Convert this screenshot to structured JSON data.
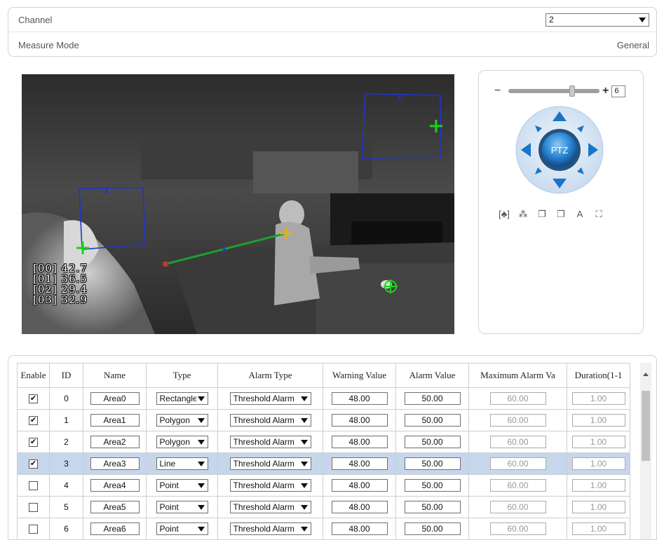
{
  "settings": {
    "channel_label": "Channel",
    "channel_value": "2",
    "measure_mode_label": "Measure Mode",
    "measure_mode_value": "General"
  },
  "video": {
    "osd_lines": [
      "[00] 42.7",
      "[01] 36.5",
      "[02] 29.4",
      "[03] 32.9"
    ],
    "area_labels": [
      "1",
      "2",
      "3"
    ]
  },
  "ptz": {
    "zoom_value": "6",
    "zoom_level_fraction": 0.7,
    "center_label": "PTZ",
    "tools": [
      "[♣]",
      "⁂",
      "❐",
      "❐",
      "A",
      "⛶"
    ]
  },
  "table": {
    "headers": [
      "Enable",
      "ID",
      "Name",
      "Type",
      "Alarm Type",
      "Warning Value",
      "Alarm Value",
      "Maximum Alarm Va",
      "Duration(1-1"
    ],
    "rows": [
      {
        "enabled": "✔",
        "id": "0",
        "name": "Area0",
        "type": "Rectangle",
        "alarm_type": "Threshold Alarm",
        "warning": "48.00",
        "alarm": "50.00",
        "max_alarm": "60.00",
        "duration": "1.00"
      },
      {
        "enabled": "✔",
        "id": "1",
        "name": "Area1",
        "type": "Polygon",
        "alarm_type": "Threshold Alarm",
        "warning": "48.00",
        "alarm": "50.00",
        "max_alarm": "60.00",
        "duration": "1.00"
      },
      {
        "enabled": "✔",
        "id": "2",
        "name": "Area2",
        "type": "Polygon",
        "alarm_type": "Threshold Alarm",
        "warning": "48.00",
        "alarm": "50.00",
        "max_alarm": "60.00",
        "duration": "1.00"
      },
      {
        "enabled": "✔",
        "id": "3",
        "name": "Area3",
        "type": "Line",
        "alarm_type": "Threshold Alarm",
        "warning": "48.00",
        "alarm": "50.00",
        "max_alarm": "60.00",
        "duration": "1.00"
      },
      {
        "enabled": "",
        "id": "4",
        "name": "Area4",
        "type": "Point",
        "alarm_type": "Threshold Alarm",
        "warning": "48.00",
        "alarm": "50.00",
        "max_alarm": "60.00",
        "duration": "1.00"
      },
      {
        "enabled": "",
        "id": "5",
        "name": "Area5",
        "type": "Point",
        "alarm_type": "Threshold Alarm",
        "warning": "48.00",
        "alarm": "50.00",
        "max_alarm": "60.00",
        "duration": "1.00"
      },
      {
        "enabled": "",
        "id": "6",
        "name": "Area6",
        "type": "Point",
        "alarm_type": "Threshold Alarm",
        "warning": "48.00",
        "alarm": "50.00",
        "max_alarm": "60.00",
        "duration": "1.00"
      }
    ]
  },
  "colors": {
    "selected_row": "#c6d7ec",
    "area_outline": "#1f35c9",
    "marker_green": "#1fd11f",
    "line_green": "#1f9e2e",
    "ptz_blue": "#1c74c8"
  }
}
